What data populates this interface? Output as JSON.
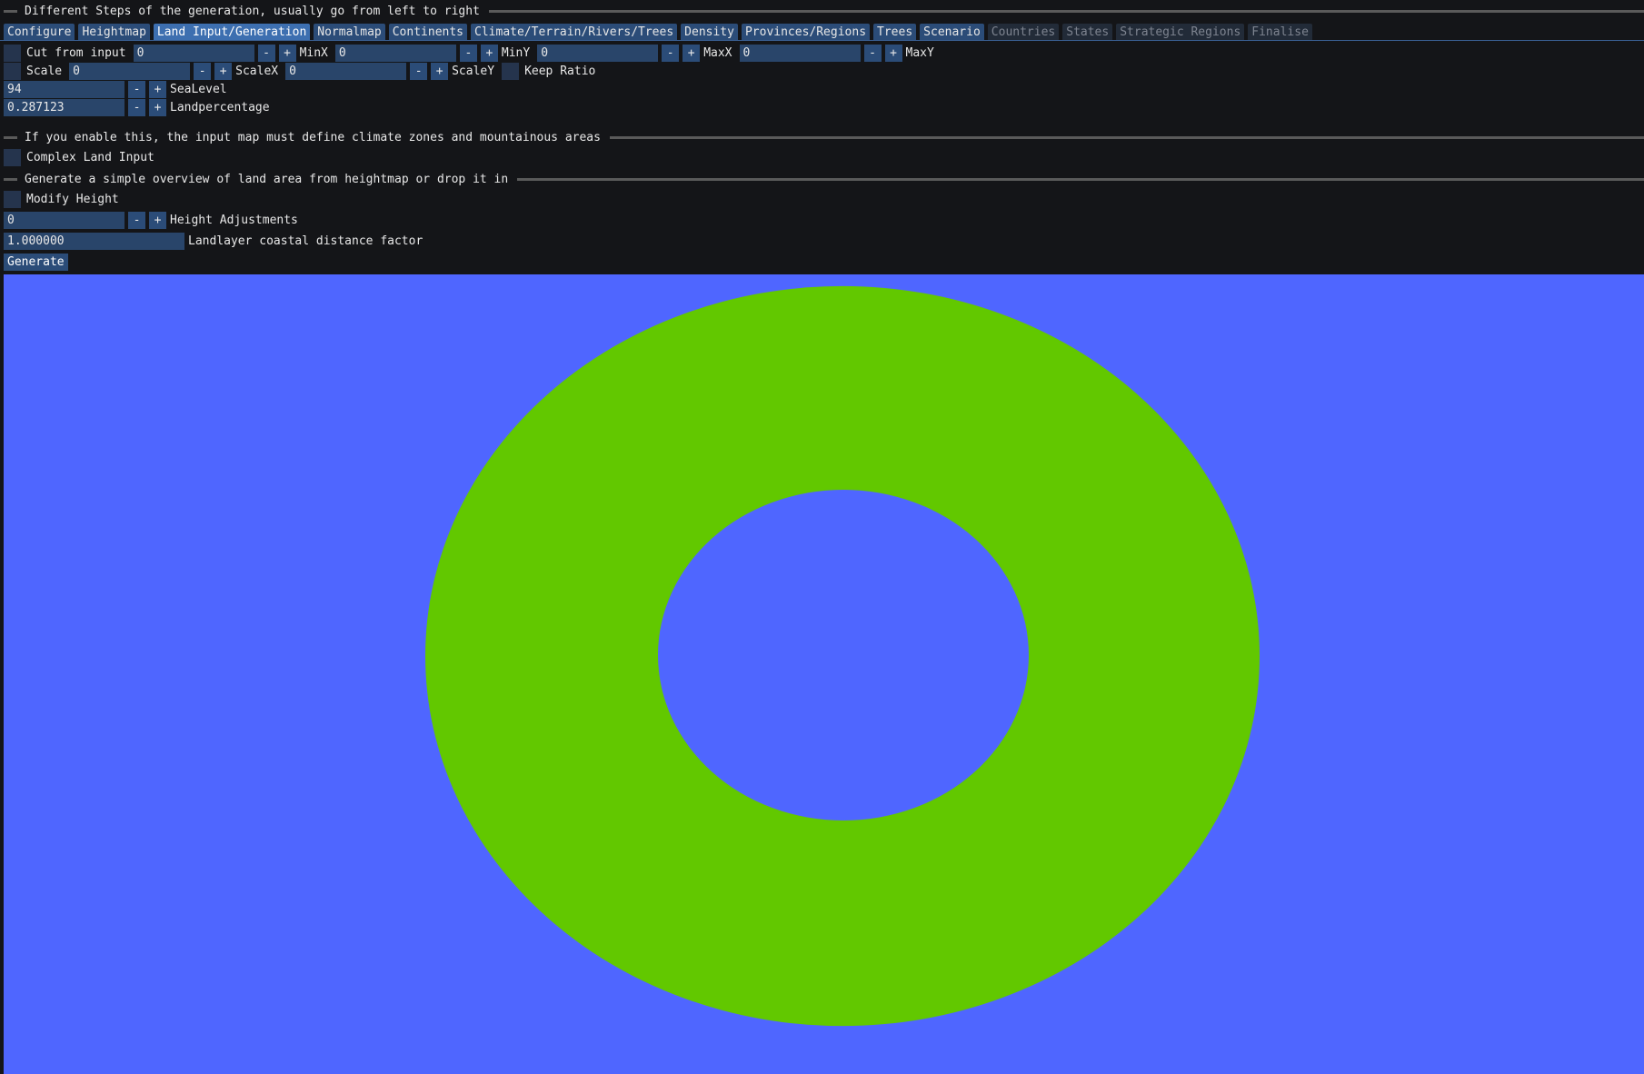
{
  "header": {
    "steps_title": "Different Steps of the generation, usually go from left to right"
  },
  "tabs": [
    {
      "label": "Configure",
      "state": "normal"
    },
    {
      "label": "Heightmap",
      "state": "normal"
    },
    {
      "label": "Land Input/Generation",
      "state": "active"
    },
    {
      "label": "Normalmap",
      "state": "normal"
    },
    {
      "label": "Continents",
      "state": "normal"
    },
    {
      "label": "Climate/Terrain/Rivers/Trees",
      "state": "normal"
    },
    {
      "label": "Density",
      "state": "normal"
    },
    {
      "label": "Provinces/Regions",
      "state": "normal"
    },
    {
      "label": "Trees",
      "state": "normal"
    },
    {
      "label": "Scenario",
      "state": "normal"
    },
    {
      "label": "Countries",
      "state": "disabled"
    },
    {
      "label": "States",
      "state": "disabled"
    },
    {
      "label": "Strategic Regions",
      "state": "disabled"
    },
    {
      "label": "Finalise",
      "state": "disabled"
    }
  ],
  "cut": {
    "label": "Cut from input",
    "minx_value": "0",
    "minx_label": "MinX",
    "miny_value": "0",
    "miny_label": "MinY",
    "maxx_value": "0",
    "maxx_label": "MaxX",
    "maxy_value": "0",
    "maxy_label": "MaxY"
  },
  "scale": {
    "label": "Scale",
    "scalex_value": "0",
    "scalex_label": "ScaleX",
    "scaley_value": "0",
    "scaley_label": "ScaleY",
    "keep_ratio_label": "Keep Ratio"
  },
  "sealevel": {
    "value": "94",
    "label": "SeaLevel"
  },
  "landpercentage": {
    "value": "0.287123",
    "label": "Landpercentage"
  },
  "complex_section": {
    "title": "If you enable this, the input map must define climate zones and mountainous areas",
    "checkbox_label": "Complex Land Input"
  },
  "simple_section": {
    "title": "Generate a simple overview of land area from heightmap or drop it in",
    "modify_height_label": "Modify Height",
    "height_adj_value": "0",
    "height_adj_label": "Height Adjustments",
    "coastal_value": "1.000000",
    "coastal_label": "Landlayer coastal distance factor",
    "generate_label": "Generate"
  },
  "stepper": {
    "minus": "-",
    "plus": "+"
  },
  "map": {
    "water_color": "#4f66ff",
    "land_color": "#62c800"
  }
}
